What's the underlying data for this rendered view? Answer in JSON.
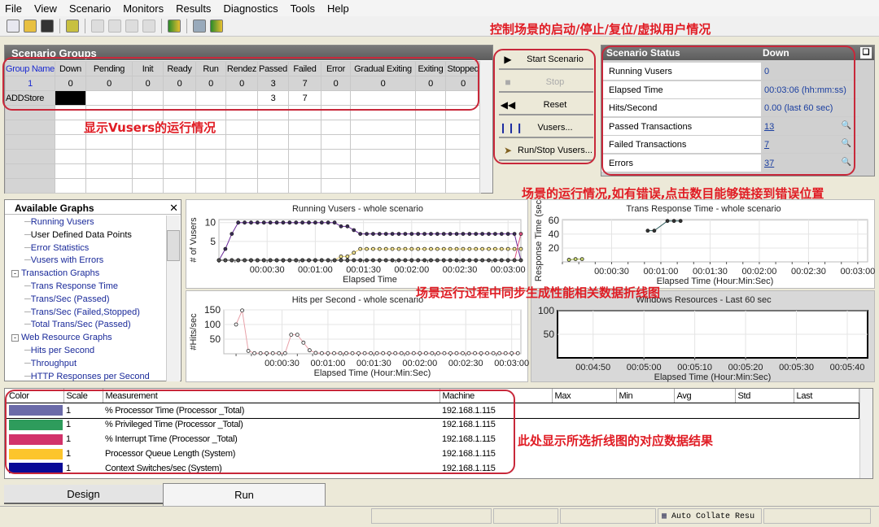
{
  "menu": [
    "File",
    "View",
    "Scenario",
    "Monitors",
    "Results",
    "Diagnostics",
    "Tools",
    "Help"
  ],
  "toolbar_icons": [
    "new-scenario-icon",
    "open-icon",
    "save-icon",
    "analyze-icon",
    "run-icon",
    "stop-icon",
    "reset-icon",
    "vusers-icon",
    "design-icon",
    "monitor-icon",
    "results-icon"
  ],
  "annotations": {
    "controls": "控制场景的启动/停止/复位/虚拟用户情况",
    "vusers": "显示Vusers的运行情况",
    "status": "场景的运行情况,如有错误,点击数目能够链接到错误位置",
    "graphs": "场景运行过程中同步生成性能相关数据折线图",
    "results": "此处显示所选折线图的对应数据结果"
  },
  "groups": {
    "title": "Scenario Groups",
    "columns": [
      "Group Name",
      "Down",
      "Pending",
      "Init",
      "Ready",
      "Run",
      "Rendez",
      "Passed",
      "Failed",
      "Error",
      "Gradual Exiting",
      "Exiting",
      "Stopped"
    ],
    "totals": [
      "1",
      "0",
      "0",
      "0",
      "0",
      "0",
      "0",
      "3",
      "7",
      "0",
      "0",
      "0",
      "0"
    ],
    "rows": [
      [
        "ADDStore",
        "",
        "",
        "",
        "",
        "",
        "",
        "3",
        "7",
        "",
        "",
        "",
        ""
      ]
    ]
  },
  "buttons": {
    "start": "Start Scenario",
    "stop": "Stop",
    "reset": "Reset",
    "vusers": "Vusers...",
    "runstop": "Run/Stop Vusers..."
  },
  "status": {
    "title": "Scenario Status",
    "state": "Down",
    "rows": [
      {
        "label": "Running Vusers",
        "value": "0"
      },
      {
        "label": "Elapsed Time",
        "value": "00:03:06 (hh:mm:ss)"
      },
      {
        "label": "Hits/Second",
        "value": "0.00 (last 60 sec)"
      },
      {
        "label": "Passed Transactions",
        "value": "13",
        "link": true
      },
      {
        "label": "Failed Transactions",
        "value": "7",
        "link": true
      },
      {
        "label": "Errors",
        "value": "37",
        "link": true
      }
    ]
  },
  "available_graphs": {
    "title": "Available Graphs",
    "items": [
      {
        "label": "Running Vusers",
        "level": 2
      },
      {
        "label": "User Defined Data Points",
        "level": 2,
        "plain": true
      },
      {
        "label": "Error Statistics",
        "level": 2
      },
      {
        "label": "Vusers with Errors",
        "level": 2
      },
      {
        "label": "Transaction Graphs",
        "level": 1
      },
      {
        "label": "Trans Response Time",
        "level": 2
      },
      {
        "label": "Trans/Sec (Passed)",
        "level": 2
      },
      {
        "label": "Trans/Sec (Failed,Stopped)",
        "level": 2
      },
      {
        "label": "Total Trans/Sec (Passed)",
        "level": 2
      },
      {
        "label": "Web Resource Graphs",
        "level": 1
      },
      {
        "label": "Hits per Second",
        "level": 2
      },
      {
        "label": "Throughput",
        "level": 2
      },
      {
        "label": "HTTP Responses per Second",
        "level": 2
      }
    ]
  },
  "charts": {
    "vusers": {
      "title": "Running Vusers - whole scenario",
      "ylabel": "# of Vusers",
      "xlabel": "Elapsed Time",
      "x_range": [
        "00:00:00",
        "00:03:08"
      ],
      "y_range": [
        0,
        10.8
      ],
      "y_ticks": [
        "10",
        "5"
      ],
      "x_ticks": [
        "00:00:30",
        "00:01:00",
        "00:01:30",
        "00:02:00",
        "00:02:30",
        "00:03:00"
      ],
      "x": [
        "00:00:00",
        "00:00:04",
        "00:00:08",
        "00:00:12",
        "00:00:16",
        "00:00:20",
        "00:00:24",
        "00:00:28",
        "00:00:32",
        "00:00:36",
        "00:00:40",
        "00:00:44",
        "00:00:48",
        "00:00:52",
        "00:00:56",
        "00:01:00",
        "00:01:04",
        "00:01:08",
        "00:01:12",
        "00:01:16",
        "00:01:20",
        "00:01:24",
        "00:01:28",
        "00:01:32",
        "00:01:36",
        "00:01:40",
        "00:01:44",
        "00:01:48",
        "00:01:52",
        "00:01:56",
        "00:02:00",
        "00:02:04",
        "00:02:08",
        "00:02:12",
        "00:02:16",
        "00:02:20",
        "00:02:24",
        "00:02:28",
        "00:02:32",
        "00:02:36",
        "00:02:40",
        "00:02:44",
        "00:02:48",
        "00:02:52",
        "00:02:56",
        "00:03:00",
        "00:03:04",
        "00:03:08"
      ],
      "series": [
        {
          "color": "#6a2a9a",
          "dot": "#3a2a5a",
          "values": [
            0,
            3,
            7,
            10,
            10,
            10,
            10,
            10,
            10,
            10,
            10,
            10,
            10,
            10,
            10,
            10,
            10,
            10,
            10,
            9,
            9,
            8,
            7,
            7,
            7,
            7,
            7,
            7,
            7,
            7,
            7,
            7,
            7,
            7,
            7,
            7,
            7,
            7,
            7,
            7,
            7,
            7,
            7,
            7,
            7,
            7,
            7,
            0
          ]
        },
        {
          "color": "#f0d060",
          "dot": "#f8e890",
          "values": [
            0,
            0,
            0,
            0,
            0,
            0,
            0,
            0,
            0,
            0,
            0,
            0,
            0,
            0,
            0,
            0,
            0,
            0,
            0,
            1,
            1,
            2,
            3,
            3,
            3,
            3,
            3,
            3,
            3,
            3,
            3,
            3,
            3,
            3,
            3,
            3,
            3,
            3,
            3,
            3,
            3,
            3,
            3,
            3,
            3,
            3,
            3,
            3
          ]
        },
        {
          "color": "#e05080",
          "dot": "#e05080",
          "values": [
            0,
            0,
            0,
            0,
            0,
            0,
            0,
            0,
            0,
            0,
            0,
            0,
            0,
            0,
            0,
            0,
            0,
            0,
            0,
            0,
            0,
            0,
            0,
            0,
            0,
            0,
            0,
            0,
            0,
            0,
            0,
            0,
            0,
            0,
            0,
            0,
            0,
            0,
            0,
            0,
            0,
            0,
            0,
            0,
            0,
            0,
            0,
            7
          ]
        },
        {
          "color": "#333333",
          "dot": "#555555",
          "values": [
            0,
            0,
            0,
            0,
            0,
            0,
            0,
            0,
            0,
            0,
            0,
            0,
            0,
            0,
            0,
            0,
            0,
            0,
            0,
            0,
            0,
            0,
            0,
            0,
            0,
            0,
            0,
            0,
            0,
            0,
            0,
            0,
            0,
            0,
            0,
            0,
            0,
            0,
            0,
            0,
            0,
            0,
            0,
            0,
            0,
            0,
            0,
            0
          ]
        }
      ]
    },
    "hits": {
      "title": "Hits per Second - whole scenario",
      "ylabel": "#Hits/sec",
      "xlabel": "Elapsed Time (Hour:Min:Sec)",
      "x_range": [
        "-00:00:08",
        "00:03:06"
      ],
      "y_range": [
        0,
        150
      ],
      "y_ticks": [
        "150",
        "100",
        "50"
      ],
      "x_ticks": [
        "00:00:30",
        "00:01:00",
        "00:01:30",
        "00:02:00",
        "00:02:30",
        "00:03:00"
      ],
      "x": [
        "00:00:00",
        "00:00:04",
        "00:00:08",
        "00:00:12",
        "00:00:16",
        "00:00:20",
        "00:00:24",
        "00:00:28",
        "00:00:32",
        "00:00:36",
        "00:00:40",
        "00:00:44",
        "00:00:48",
        "00:00:52",
        "00:00:56",
        "00:01:00",
        "00:01:04",
        "00:01:08",
        "00:01:12",
        "00:01:16",
        "00:01:20",
        "00:01:24",
        "00:01:28",
        "00:01:32",
        "00:01:36",
        "00:01:40",
        "00:01:44",
        "00:01:48",
        "00:01:52",
        "00:01:56",
        "00:02:00",
        "00:02:04",
        "00:02:08",
        "00:02:12",
        "00:02:16",
        "00:02:20",
        "00:02:24",
        "00:02:28",
        "00:02:32",
        "00:02:36",
        "00:02:40",
        "00:02:44",
        "00:02:48",
        "00:02:52",
        "00:02:56",
        "00:03:00",
        "00:03:04"
      ],
      "series": [
        {
          "color": "#e8a0a8",
          "dot": "#ffffff",
          "values": [
            100,
            148,
            10,
            2,
            2,
            2,
            2,
            2,
            2,
            65,
            65,
            38,
            12,
            3,
            2,
            2,
            2,
            2,
            2,
            2,
            2,
            2,
            2,
            2,
            2,
            2,
            2,
            2,
            2,
            2,
            2,
            2,
            2,
            2,
            2,
            2,
            2,
            2,
            2,
            2,
            2,
            2,
            2,
            2,
            2,
            2,
            2
          ]
        }
      ]
    },
    "trans": {
      "title": "Trans Response Time - whole scenario",
      "ylabel": "Response Time (sec",
      "xlabel": "Elapsed Time (Hour:Min:Sec)",
      "x_range": [
        "00:00:00",
        "00:03:06"
      ],
      "y_range": [
        0,
        61
      ],
      "y_ticks": [
        "60",
        "40",
        "20"
      ],
      "x_ticks": [
        "00:00:30",
        "00:01:00",
        "00:01:30",
        "00:02:00",
        "00:02:30",
        "00:03:00"
      ],
      "series": [
        {
          "color": "#a0b040",
          "dot": "#c8d870",
          "x": [
            "00:00:04",
            "00:00:08",
            "00:00:12"
          ],
          "values": [
            3,
            4,
            4
          ]
        },
        {
          "color": "#2a5a5a",
          "dot": "#333333",
          "x": [
            "00:00:52",
            "00:00:56",
            "00:01:04",
            "00:01:08",
            "00:01:12"
          ],
          "values": [
            45,
            45,
            59,
            59,
            59
          ]
        }
      ]
    },
    "winres": {
      "title": "Windows Resources - Last 60 sec",
      "ylabel": "",
      "xlabel": "Elapsed Time (Hour:Min:Sec)",
      "x_range": [
        "00:04:43",
        "00:05:44"
      ],
      "y_range": [
        0,
        100
      ],
      "y_ticks": [
        "100",
        "50"
      ],
      "x_ticks": [
        "00:04:50",
        "00:05:00",
        "00:05:10",
        "00:05:20",
        "00:05:30",
        "00:05:40"
      ],
      "series": []
    }
  },
  "measurements": {
    "columns": [
      "Color",
      "Scale",
      "Measurement",
      "Machine",
      "Max",
      "Min",
      "Avg",
      "Std",
      "Last"
    ],
    "rows": [
      {
        "color": "#6a6aa8",
        "scale": "1",
        "measurement": "% Processor Time (Processor _Total)",
        "machine": "192.168.1.115"
      },
      {
        "color": "#2e9c5c",
        "scale": "1",
        "measurement": "% Privileged Time (Processor _Total)",
        "machine": "192.168.1.115"
      },
      {
        "color": "#d2336a",
        "scale": "1",
        "measurement": "% Interrupt Time (Processor _Total)",
        "machine": "192.168.1.115"
      },
      {
        "color": "#fcc52c",
        "scale": "1",
        "measurement": "Processor Queue Length (System)",
        "machine": "192.168.1.115"
      },
      {
        "color": "#0a0a96",
        "scale": "1",
        "measurement": "Context Switches/sec (System)",
        "machine": "192.168.1.115"
      }
    ]
  },
  "tabs": {
    "design": "Design",
    "run": "Run",
    "active": "Run"
  },
  "statusbar": {
    "auto_collate": "Auto Collate Resu"
  }
}
